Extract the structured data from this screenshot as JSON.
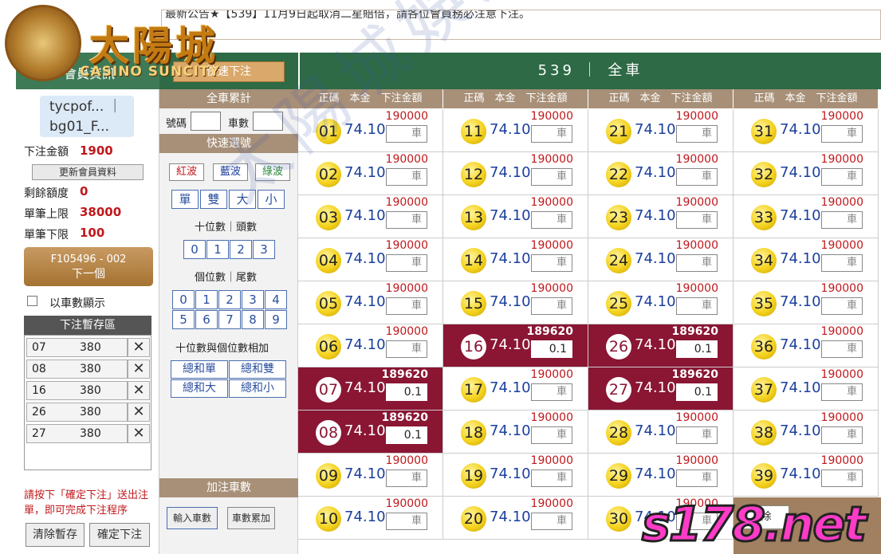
{
  "marquee": "最新公告★【539】11月9日起取消二星賠倍，請各位會員務必注意下注。",
  "logo": {
    "title": "太陽城",
    "subtitle": "CASINO SUNCITY"
  },
  "header": {
    "member_tab": "會員資訊",
    "quick_button": "快速下注",
    "game_title": "539 ｜ 全車"
  },
  "user": {
    "name_line1": "tycpof... ｜",
    "name_line2": "bg01_F..."
  },
  "account": {
    "bet_label": "下注金額",
    "bet_value": "1900",
    "update_button": "更新會員資料",
    "remaining_label": "剩餘額度",
    "remaining_value": "0",
    "max_label": "單筆上限",
    "max_value": "38000",
    "min_label": "單筆下限",
    "min_value": "100",
    "next_line1": "F105496 - 002",
    "next_line2": "下一個",
    "checkbox_label": "以車數顯示"
  },
  "temp": {
    "title": "下注暫存區",
    "rows": [
      {
        "num": "07",
        "amt": "380"
      },
      {
        "num": "08",
        "amt": "380"
      },
      {
        "num": "16",
        "amt": "380"
      },
      {
        "num": "26",
        "amt": "380"
      },
      {
        "num": "27",
        "amt": "380"
      }
    ],
    "remove_icon": "✕"
  },
  "note": "請按下「確定下注」送出注單，即可完成下注程序",
  "buttons": {
    "clear": "清除暫存",
    "confirm": "確定下注"
  },
  "mid": {
    "total_head": "全車累計",
    "num_label": "號碼",
    "count_label": "車數",
    "quick_head": "快速選號",
    "waves": [
      "紅波",
      "藍波",
      "綠波"
    ],
    "wave_colors": [
      "#c0181c",
      "#1b3f9e",
      "#2d8a3a"
    ],
    "oddeven": [
      "單",
      "雙",
      "大",
      "小"
    ],
    "tens_label": "十位數｜頭數",
    "tens": [
      "0",
      "1",
      "2",
      "3"
    ],
    "units_label": "個位數｜尾數",
    "units": [
      "0",
      "1",
      "2",
      "3",
      "4",
      "5",
      "6",
      "7",
      "8",
      "9"
    ],
    "sum_label": "十位數與個位數相加",
    "sums": [
      "總和單",
      "總和雙",
      "總和大",
      "總和小"
    ],
    "add_head": "加注車數",
    "input_btn": "輸入車數",
    "accum_btn": "車數累加"
  },
  "grid": {
    "col_header": "正碼　本金　下注金額",
    "placeholder": "車",
    "rows": [
      [
        {
          "n": "01",
          "r": "74.10",
          "l": "190000",
          "s": false,
          "v": "車"
        },
        {
          "n": "11",
          "r": "74.10",
          "l": "190000",
          "s": false,
          "v": "車"
        },
        {
          "n": "21",
          "r": "74.10",
          "l": "190000",
          "s": false,
          "v": "車"
        },
        {
          "n": "31",
          "r": "74.10",
          "l": "190000",
          "s": false,
          "v": "車"
        }
      ],
      [
        {
          "n": "02",
          "r": "74.10",
          "l": "190000",
          "s": false,
          "v": "車"
        },
        {
          "n": "12",
          "r": "74.10",
          "l": "190000",
          "s": false,
          "v": "車"
        },
        {
          "n": "22",
          "r": "74.10",
          "l": "190000",
          "s": false,
          "v": "車"
        },
        {
          "n": "32",
          "r": "74.10",
          "l": "190000",
          "s": false,
          "v": "車"
        }
      ],
      [
        {
          "n": "03",
          "r": "74.10",
          "l": "190000",
          "s": false,
          "v": "車"
        },
        {
          "n": "13",
          "r": "74.10",
          "l": "190000",
          "s": false,
          "v": "車"
        },
        {
          "n": "23",
          "r": "74.10",
          "l": "190000",
          "s": false,
          "v": "車"
        },
        {
          "n": "33",
          "r": "74.10",
          "l": "190000",
          "s": false,
          "v": "車"
        }
      ],
      [
        {
          "n": "04",
          "r": "74.10",
          "l": "190000",
          "s": false,
          "v": "車"
        },
        {
          "n": "14",
          "r": "74.10",
          "l": "190000",
          "s": false,
          "v": "車"
        },
        {
          "n": "24",
          "r": "74.10",
          "l": "190000",
          "s": false,
          "v": "車"
        },
        {
          "n": "34",
          "r": "74.10",
          "l": "190000",
          "s": false,
          "v": "車"
        }
      ],
      [
        {
          "n": "05",
          "r": "74.10",
          "l": "190000",
          "s": false,
          "v": "車"
        },
        {
          "n": "15",
          "r": "74.10",
          "l": "190000",
          "s": false,
          "v": "車"
        },
        {
          "n": "25",
          "r": "74.10",
          "l": "190000",
          "s": false,
          "v": "車"
        },
        {
          "n": "35",
          "r": "74.10",
          "l": "190000",
          "s": false,
          "v": "車"
        }
      ],
      [
        {
          "n": "06",
          "r": "74.10",
          "l": "190000",
          "s": false,
          "v": "車"
        },
        {
          "n": "16",
          "r": "74.10",
          "l": "189620",
          "s": true,
          "v": "0.1"
        },
        {
          "n": "26",
          "r": "74.10",
          "l": "189620",
          "s": true,
          "v": "0.1"
        },
        {
          "n": "36",
          "r": "74.10",
          "l": "190000",
          "s": false,
          "v": "車"
        }
      ],
      [
        {
          "n": "07",
          "r": "74.10",
          "l": "189620",
          "s": true,
          "v": "0.1"
        },
        {
          "n": "17",
          "r": "74.10",
          "l": "190000",
          "s": false,
          "v": "車"
        },
        {
          "n": "27",
          "r": "74.10",
          "l": "189620",
          "s": true,
          "v": "0.1"
        },
        {
          "n": "37",
          "r": "74.10",
          "l": "190000",
          "s": false,
          "v": "車"
        }
      ],
      [
        {
          "n": "08",
          "r": "74.10",
          "l": "189620",
          "s": true,
          "v": "0.1"
        },
        {
          "n": "18",
          "r": "74.10",
          "l": "190000",
          "s": false,
          "v": "車"
        },
        {
          "n": "28",
          "r": "74.10",
          "l": "190000",
          "s": false,
          "v": "車"
        },
        {
          "n": "38",
          "r": "74.10",
          "l": "190000",
          "s": false,
          "v": "車"
        }
      ],
      [
        {
          "n": "09",
          "r": "74.10",
          "l": "190000",
          "s": false,
          "v": "車"
        },
        {
          "n": "19",
          "r": "74.10",
          "l": "190000",
          "s": false,
          "v": "車"
        },
        {
          "n": "29",
          "r": "74.10",
          "l": "190000",
          "s": false,
          "v": "車"
        },
        {
          "n": "39",
          "r": "74.10",
          "l": "190000",
          "s": false,
          "v": "車"
        }
      ],
      [
        {
          "n": "10",
          "r": "74.10",
          "l": "190000",
          "s": false,
          "v": "車"
        },
        {
          "n": "20",
          "r": "74.10",
          "l": "190000",
          "s": false,
          "v": "車"
        },
        {
          "n": "30",
          "r": "74.10",
          "l": "190000",
          "s": false,
          "v": "車"
        }
      ]
    ]
  },
  "bottom_partial_button": "除",
  "watermark": "太陽城娛樂城提供",
  "site_mark": "s178.net"
}
